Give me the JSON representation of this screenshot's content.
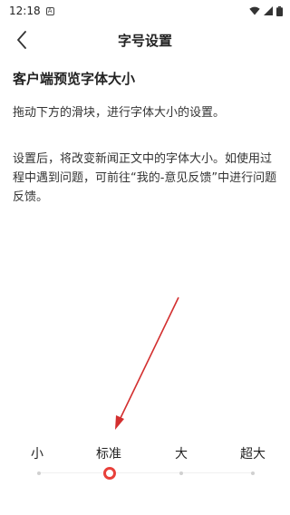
{
  "status_bar": {
    "time": "12:18",
    "notification_icon": "font-a-icon",
    "icons": [
      "wifi-icon",
      "signal-icon",
      "battery-icon"
    ]
  },
  "header": {
    "title": "字号设置",
    "back_icon": "chevron-left-icon"
  },
  "content": {
    "preview_heading": "客户端预览字体大小",
    "instruction": "拖动下方的滑块，进行字体大小的设置。",
    "note": "设置后，将改变新闻正文中的字体大小。如使用过程中遇到问题，可前往“我的-意见反馈”中进行问题反馈。"
  },
  "font_size_slider": {
    "options": [
      "小",
      "标准",
      "大",
      "超大"
    ],
    "selected": "标准",
    "selected_index": 1,
    "accent_color": "#e8403a"
  },
  "annotation": {
    "color": "#d32f2f"
  }
}
